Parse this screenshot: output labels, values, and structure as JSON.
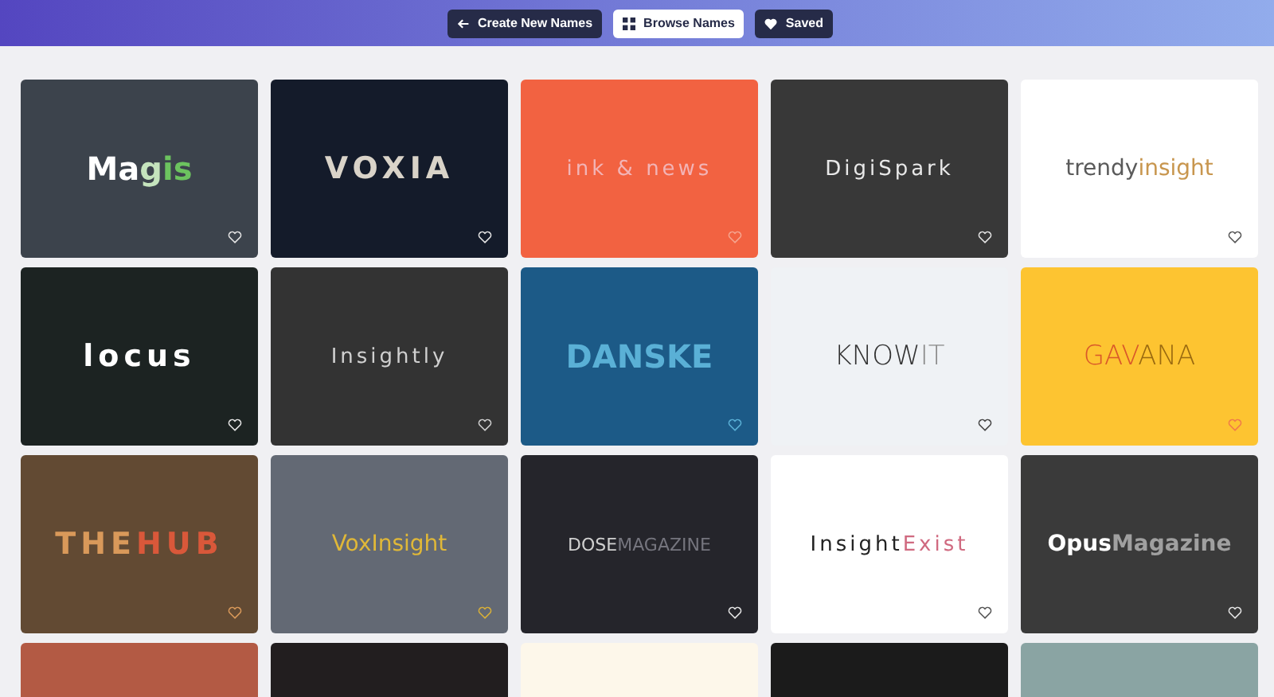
{
  "nav": [
    {
      "kind": "back",
      "label": "Create New Names",
      "selected": false
    },
    {
      "kind": "grid",
      "label": "Browse Names",
      "selected": true
    },
    {
      "kind": "heart",
      "label": "Saved",
      "selected": false
    }
  ],
  "cards": [
    {
      "color": "#3c434c",
      "kind": "bold",
      "heart": {
        "color": "#e6e6e6"
      },
      "parts": [
        {
          "text": "Ma",
          "color": "#ffffff"
        },
        {
          "text": "g",
          "color": "#c5e4bd"
        },
        {
          "text": "is",
          "color": "#6cc35f"
        }
      ]
    },
    {
      "color": "#141b2a",
      "kind": "wide",
      "heart": {
        "color": "#e6e6e6"
      },
      "parts": [
        {
          "text": "VOXIA",
          "color": "#d9d3c8"
        }
      ]
    },
    {
      "color": "#f26241",
      "kind": "spaced",
      "heart": {
        "color": "#f5a58f"
      },
      "parts": [
        {
          "text": "ink & news",
          "color": "#f2b4b6"
        }
      ]
    },
    {
      "color": "#383838",
      "kind": "spaced",
      "heart": {
        "color": "#e6e6e6"
      },
      "parts": [
        {
          "text": "DigiSpark",
          "color": "#e8e8e8"
        }
      ]
    },
    {
      "color": "#ffffff",
      "kind": "plain",
      "heart": {
        "color": "#555555"
      },
      "parts": [
        {
          "text": "trendy",
          "color": "#5a5a5a"
        },
        {
          "text": "insight",
          "color": "#c8964e"
        }
      ]
    },
    {
      "color": "#1c2322",
      "kind": "wide",
      "heart": {
        "color": "#e6e6e6"
      },
      "parts": [
        {
          "text": "locus",
          "color": "#ffffff"
        }
      ]
    },
    {
      "color": "#333333",
      "kind": "spaced",
      "heart": {
        "color": "#d0d0d0"
      },
      "parts": [
        {
          "text": "Insightly",
          "color": "#d0d0d0"
        }
      ]
    },
    {
      "color": "#1c5a87",
      "kind": "bold",
      "heart": {
        "color": "#5ab0d6"
      },
      "parts": [
        {
          "text": "DANSKE",
          "color": "#5ab0d6"
        }
      ]
    },
    {
      "color": "#eff2f5",
      "kind": "light",
      "heart": {
        "color": "#444444"
      },
      "parts": [
        {
          "text": "KNOW",
          "color": "#333333"
        },
        {
          "text": "IT",
          "color": "#8a8a8a"
        }
      ]
    },
    {
      "color": "#fdc431",
      "kind": "light",
      "heart": {
        "color": "#f07a4a"
      },
      "parts": [
        {
          "text": "GAV",
          "color": "#d9582a"
        },
        {
          "text": "ANA",
          "color": "#9a6a10"
        }
      ]
    },
    {
      "color": "#624a33",
      "kind": "wide",
      "heart": {
        "color": "#d9995a"
      },
      "parts": [
        {
          "text": "THE",
          "color": "#d9995a"
        },
        {
          "text": "HUB",
          "color": "#d9583a"
        }
      ]
    },
    {
      "color": "#636974",
      "kind": "plain",
      "heart": {
        "color": "#d9b038"
      },
      "parts": [
        {
          "text": "VoxInsight",
          "color": "#e0b838"
        }
      ]
    },
    {
      "color": "#25252b",
      "kind": "small",
      "heart": {
        "color": "#e6e6e6"
      },
      "parts": [
        {
          "text": "DOSE",
          "color": "#d0d0d0"
        },
        {
          "text": "MAGAZINE",
          "color": "#75757e"
        }
      ]
    },
    {
      "color": "#ffffff",
      "kind": "spaced",
      "heart": {
        "color": "#555555"
      },
      "parts": [
        {
          "text": "Insight",
          "color": "#222222"
        },
        {
          "text": "Exist",
          "color": "#d06a80"
        }
      ]
    },
    {
      "color": "#3a3a3a",
      "kind": "heavy",
      "heart": {
        "color": "#e6e6e6"
      },
      "parts": [
        {
          "text": "Opus",
          "color": "#ffffff"
        },
        {
          "text": "Magazine",
          "color": "#a0a0a0"
        }
      ]
    },
    {
      "color": "#b35a44"
    },
    {
      "color": "#221e1f"
    },
    {
      "color": "#fdf7ea"
    },
    {
      "color": "#1b1b1b"
    },
    {
      "color": "#8aa4a3"
    }
  ]
}
